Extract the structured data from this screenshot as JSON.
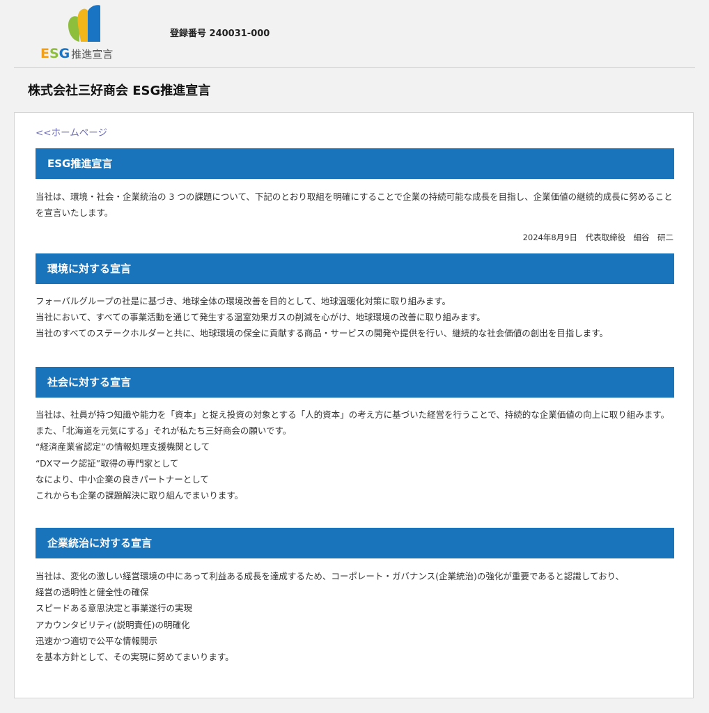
{
  "header": {
    "logo": {
      "letters": [
        "E",
        "S",
        "G"
      ],
      "suffix": "推進宣言",
      "colors": {
        "e": "#f2a01a",
        "s": "#8dbe3c",
        "g": "#1a74c4",
        "leaf_green": "#8dbe3c",
        "leaf_yellow": "#f2b51a",
        "leaf_blue": "#1a74c4"
      }
    },
    "registration": "登録番号 240031-000"
  },
  "title": "株式会社三好商会 ESG推進宣言",
  "home_link": "<<ホームページ",
  "accent_color": "#1a74bc",
  "sections": [
    {
      "heading": "ESG推進宣言",
      "paragraphs": [
        "当社は、環境・社会・企業統治の 3 つの課題について、下記のとおり取組を明確にすることで企業の持続可能な成長を目指し、企業価値の継続的成長に努めることを宣言いたします。"
      ],
      "signature": "2024年8月9日　代表取締役　細谷　研二"
    },
    {
      "heading": "環境に対する宣言",
      "paragraphs": [
        "フォーバルグループの社是に基づき、地球全体の環境改善を目的として、地球温暖化対策に取り組みます。",
        "当社において、すべての事業活動を通じて発生する温室効果ガスの削減を心がけ、地球環境の改善に取り組みます。",
        "当社のすべてのステークホルダーと共に、地球環境の保全に貢献する商品・サービスの開発や提供を行い、継続的な社会価値の創出を目指します。"
      ]
    },
    {
      "heading": "社会に対する宣言",
      "paragraphs": [
        "当社は、社員が持つ知識や能力を「資本」と捉え投資の対象とする「人的資本」の考え方に基づいた経営を行うことで、持続的な企業価値の向上に取り組みます。",
        "また、「北海道を元気にする」それが私たち三好商会の願いです。",
        "“経済産業省認定”の情報処理支援機関として",
        "“DXマーク認証”取得の専門家として",
        "なにより、中小企業の良きパートナーとして",
        "これからも企業の課題解決に取り組んでまいります。"
      ]
    },
    {
      "heading": "企業統治に対する宣言",
      "paragraphs": [
        "当社は、変化の激しい経営環境の中にあって利益ある成長を達成するため、コーポレート・ガバナンス(企業統治)の強化が重要であると認識しており、",
        "経営の透明性と健全性の確保",
        "スピードある意思決定と事業遂行の実現",
        "アカウンタビリティ(説明責任)の明確化",
        "迅速かつ適切で公平な情報開示",
        "を基本方針として、その実現に努めてまいります。"
      ]
    }
  ]
}
